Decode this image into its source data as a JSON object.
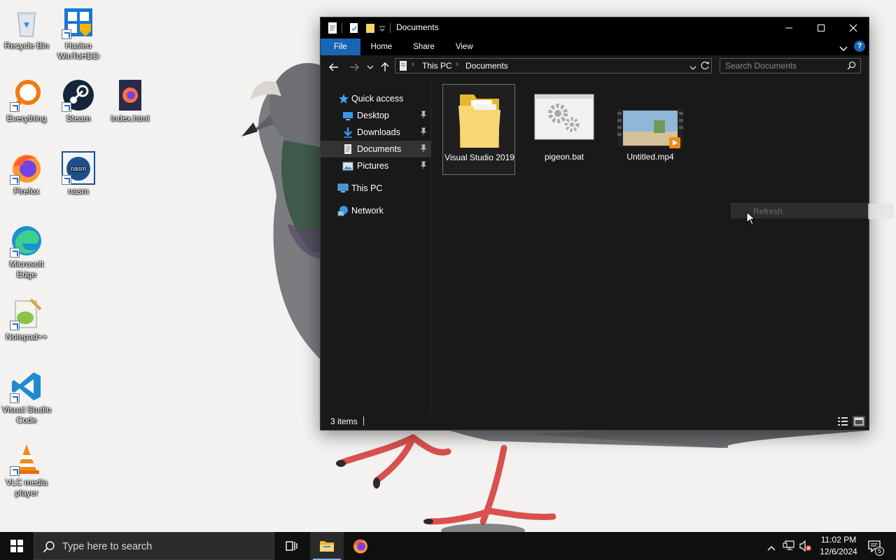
{
  "desktop": {
    "icons": [
      {
        "label": "Recycle Bin"
      },
      {
        "label": "Hasleo WinToHDD"
      },
      {
        "label": "Everything"
      },
      {
        "label": "Steam"
      },
      {
        "label": "index.html"
      },
      {
        "label": "Firefox"
      },
      {
        "label": "nasm"
      },
      {
        "label": "Microsoft Edge"
      },
      {
        "label": "Notepad++"
      },
      {
        "label": "Visual Studio Code"
      },
      {
        "label": "VLC media player"
      }
    ]
  },
  "explorer": {
    "title": "Documents",
    "ribbon_tabs": [
      "File",
      "Home",
      "Share",
      "View"
    ],
    "address": {
      "root": "This PC",
      "current": "Documents"
    },
    "search_placeholder": "Search Documents",
    "nav": {
      "quick_access": "Quick access",
      "items": [
        "Desktop",
        "Downloads",
        "Documents",
        "Pictures"
      ],
      "selected": "Documents",
      "this_pc": "This PC",
      "network": "Network"
    },
    "files": [
      {
        "name": "Visual Studio 2019",
        "type": "folder",
        "selected": true
      },
      {
        "name": "pigeon.bat",
        "type": "batch"
      },
      {
        "name": "Untitled.mp4",
        "type": "video"
      }
    ],
    "status": {
      "count": "3 items"
    },
    "context_menu_ghost": "Refresh"
  },
  "taskbar": {
    "search_placeholder": "Type here to search",
    "clock": {
      "time": "11:02 PM",
      "date": "12/6/2024"
    },
    "notifications": "5"
  },
  "colors": {
    "accent": "#1a64b4",
    "window_bg": "#191919",
    "titlebar": "#000000",
    "taskbar": "#101010"
  }
}
